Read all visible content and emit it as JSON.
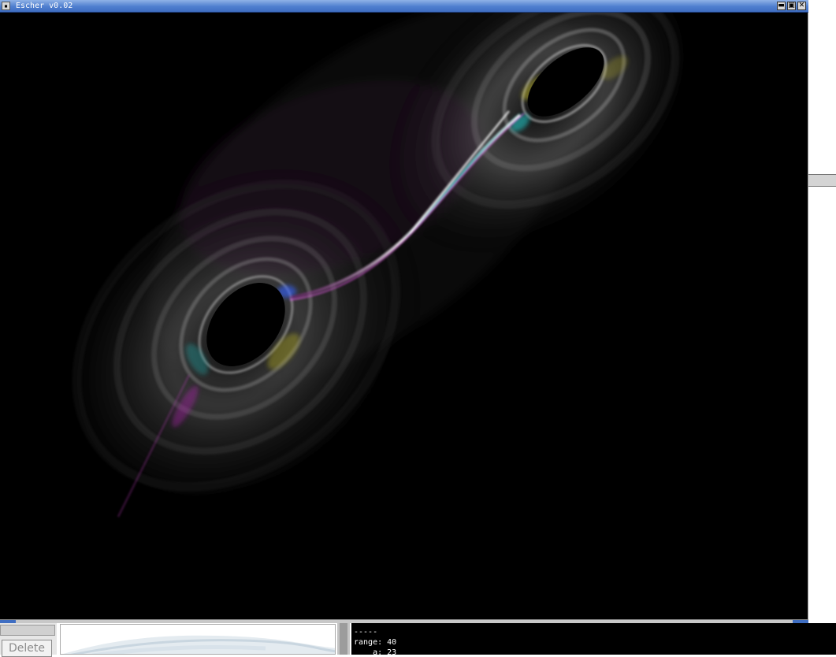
{
  "window": {
    "title": "Escher v0.02",
    "controls": {
      "menu_glyph": "▪",
      "minimize_glyph": "▬",
      "maximize_glyph": "▣",
      "close_glyph": "✕"
    },
    "titlebar_color": "#4f7fcf"
  },
  "render": {
    "description_icon": "fractal-flame-render",
    "background": "#000000",
    "accent_colors": [
      "#ffffff",
      "#d020d0",
      "#20b0b0",
      "#c8c020",
      "#3060ff"
    ]
  },
  "bottom_panel": {
    "delete_label": "Delete",
    "console_lines": [
      "-----",
      "range: 40",
      "    a: 23"
    ]
  }
}
